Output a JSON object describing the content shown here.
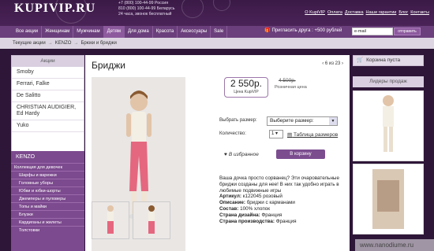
{
  "header": {
    "logo": "KUPIVIP.RU",
    "phones": [
      "+7 (800) 100-44-99 Россия",
      "810 (800) 100-44-99 Беларусь",
      "24 часа, звонок бесплатный"
    ],
    "top_links": [
      "О KupiVIP",
      "Оплата",
      "Доставка",
      "Наши гарантии",
      "Блог",
      "Контакты"
    ]
  },
  "nav": {
    "items": [
      "Все акции",
      "Женщинам",
      "Мужчинам",
      "Детям",
      "Для дома",
      "Красота",
      "Аксессуары",
      "Sale"
    ],
    "active": "Детям",
    "invite_text": "Пригласить друга : +500 рублей",
    "email_value": "e-mail",
    "send_label": "отправить"
  },
  "breadcrumb": [
    "Текущие акции",
    "KENZO",
    "Брюки и бриджи"
  ],
  "sidebar": {
    "heading": "Акции",
    "items": [
      "Smoby",
      "Ferrari, Falke",
      "De Salitto",
      "CHRISTIAN AUDIGIER, Ed Hardy",
      "Yuko"
    ],
    "section_title": "KENZO",
    "categories": [
      "Коллекция для девочек",
      "Шарфы и варежки",
      "Головные уборы",
      "Юбки и юбки-шорты",
      "Джемперы и пуловеры",
      "Топы и майки",
      "Блузки",
      "Кардиганы и жилеты",
      "Толстовки"
    ]
  },
  "product": {
    "title": "Бриджи",
    "pager": "6 из 23",
    "price": "2 550р.",
    "price_label": "Цена KupiVIP",
    "old_price": "4 500р.",
    "old_price_label": "Розничная цена",
    "size_label": "Выбрать размер:",
    "size_value": "Выберите размер:",
    "qty_label": "Количество:",
    "qty_value": "1",
    "size_table": "Таблица размеров",
    "favorite": "В избранное",
    "cart_button": "В корзину",
    "description": "Ваша дочка просто сорванец? Эти очаровательные бриджи созданы для нее! В них так удобно играть в любимые подвижные игры",
    "specs": [
      {
        "label": "Артикул:",
        "value": "к122045 розовый"
      },
      {
        "label": "Описание:",
        "value": "бриджи с карманами"
      },
      {
        "label": "Состав:",
        "value": "100% хлопок"
      },
      {
        "label": "Страна дизайна:",
        "value": "Франция"
      },
      {
        "label": "Страна производства:",
        "value": "Франция"
      }
    ]
  },
  "right": {
    "cart": "Корзина пуста",
    "leaders": "Лидеры продаж"
  },
  "watermark": "www.nanodiume.ru",
  "colors": {
    "brand": "#4a2357",
    "nav": "#6b3f7c",
    "accent": "#7b4d8f"
  }
}
